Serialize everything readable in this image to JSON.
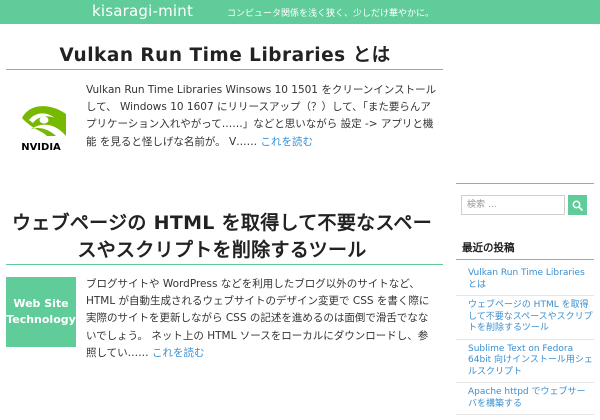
{
  "header": {
    "site_title": "kisaragi-mint",
    "tagline": "コンピュータ関係を浅く狭く、少しだけ華やかに。"
  },
  "posts": [
    {
      "title": "Vulkan Run Time Libraries とは",
      "excerpt": "Vulkan Run Time Libraries Winsows 10 1501 をクリーンインストールして、 Windows 10 1607 にリリースアップ（？）して、「また要らんアプリケーション入れやがって……」などと思いながら 設定 -> アプリと機能 を見ると怪しげな名前が。 V……",
      "read_more": "これを読む",
      "thumbnail_text": "NVIDIA"
    },
    {
      "title": "ウェブページの HTML を取得して不要なスペースやスクリプトを削除するツール",
      "excerpt": "ブログサイトや WordPress などを利用したブログ以外のサイトなど、 HTML が自動生成されるウェブサイトのデザイン変更で CSS を書く際に実際のサイトを更新しながら CSS の記述を進めるのは面倒で滑舌でなないでしょう。 ネット上の HTML ソースをローカルにダウンロードし、参照してい……",
      "read_more": "これを読む",
      "thumbnail_text": "Web Site Technology"
    }
  ],
  "sidebar": {
    "search_placeholder": "検索 …",
    "recent_title": "最近の投稿",
    "recent_posts": [
      "Vulkan Run Time Libraries とは",
      "ウェブページの HTML を取得して不要なスペースやスクリプトを削除するツール",
      "Sublime Text on Fedora 64bit 向けインストール用シェルスクリプト",
      "Apache httpd でウェブサーバを構築する"
    ]
  },
  "colors": {
    "accent": "#5fcc9a",
    "link": "#3a8fd0",
    "nvidia_green": "#76b900"
  },
  "icons": {
    "search": "magnifier-icon"
  }
}
